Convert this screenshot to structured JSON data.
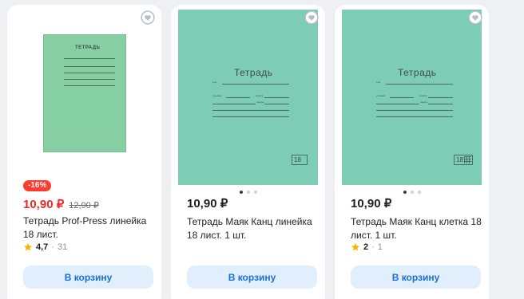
{
  "colors": {
    "accent": "#1c6fd6",
    "button_bg": "#e1eefb",
    "sale_red": "#ef2a2a",
    "badge_red": "#ff3b30",
    "notebook_green_light": "#86cfa2",
    "notebook_green_teal": "#7dcdb4",
    "star_yellow": "#f7b500"
  },
  "icons": {
    "favorite": "heart-icon",
    "rating": "star-icon"
  },
  "products": [
    {
      "badge": "-16%",
      "price": "10,90 ₽",
      "old_price": "12,90 ₽",
      "title": "Тетрадь Prof-Press линейка 18 лист.",
      "rating": "4,7",
      "reviews": "31",
      "cover_title": "ТЕТРАДЬ",
      "button_label": "В корзину"
    },
    {
      "price": "10,90 ₽",
      "title": "Тетрадь Маяк Канц линейка 18 лист. 1 шт.",
      "cover_title": "Тетрадь",
      "cover_field_1": "для",
      "cover_field_2": "ученика",
      "cover_field_3": "класса",
      "cover_field_4": "школы",
      "sheets": "18",
      "button_label": "В корзину"
    },
    {
      "price": "10,90 ₽",
      "title": "Тетрадь Маяк Канц клетка 18 лист. 1 шт.",
      "rating": "2",
      "reviews": "1",
      "cover_title": "Тетрадь",
      "cover_field_1": "для",
      "cover_field_2": "ученика",
      "cover_field_3": "класса",
      "cover_field_4": "школы",
      "sheets": "18",
      "button_label": "В корзину"
    }
  ]
}
